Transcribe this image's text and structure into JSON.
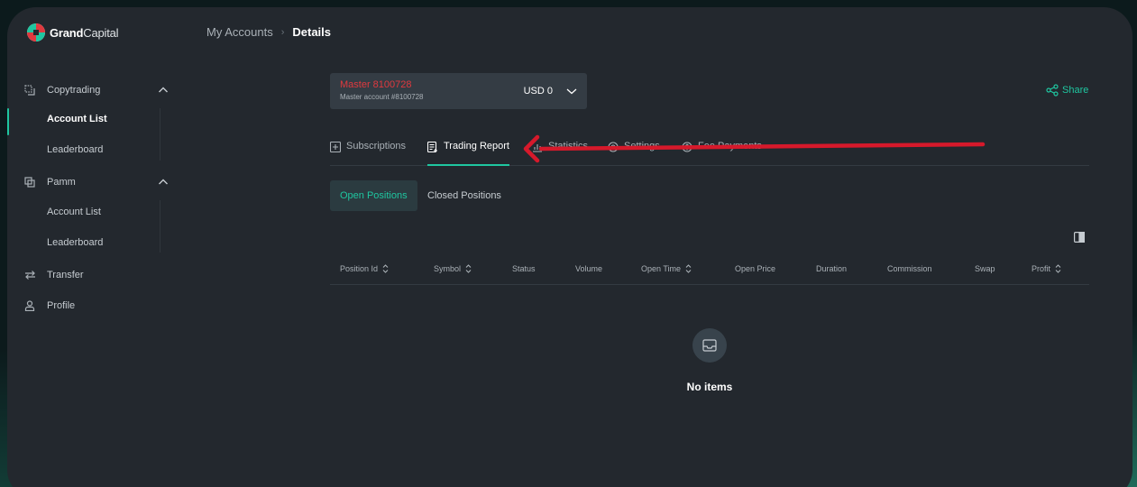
{
  "brand": {
    "name_bold": "Grand",
    "name_light": "Capital"
  },
  "breadcrumb": {
    "parent": "My Accounts",
    "separator": "›",
    "current": "Details"
  },
  "sidebar": {
    "sections": [
      {
        "label": "Copytrading",
        "icon": "copytrading-icon",
        "expanded": true,
        "items": [
          {
            "label": "Account List",
            "active": true
          },
          {
            "label": "Leaderboard",
            "active": false
          }
        ]
      },
      {
        "label": "Pamm",
        "icon": "pamm-icon",
        "expanded": true,
        "items": [
          {
            "label": "Account List",
            "active": false
          },
          {
            "label": "Leaderboard",
            "active": false
          }
        ]
      }
    ],
    "links": [
      {
        "label": "Transfer",
        "icon": "transfer-icon"
      },
      {
        "label": "Profile",
        "icon": "profile-icon"
      }
    ]
  },
  "account": {
    "name": "Master 8100728",
    "subtitle": "Master account #8100728",
    "balance": "USD 0"
  },
  "share_label": "Share",
  "tabs": [
    {
      "label": "Subscriptions",
      "icon": "plus-square-icon",
      "active": false
    },
    {
      "label": "Trading Report",
      "icon": "report-icon",
      "active": true
    },
    {
      "label": "Statistics",
      "icon": "chart-icon",
      "active": false
    },
    {
      "label": "Settings",
      "icon": "gear-icon",
      "active": false
    },
    {
      "label": "Fee Payments",
      "icon": "dollar-circle-icon",
      "active": false
    }
  ],
  "subtabs": [
    {
      "label": "Open Positions",
      "active": true
    },
    {
      "label": "Closed Positions",
      "active": false
    }
  ],
  "table": {
    "columns": [
      {
        "label": "Position Id",
        "sortable": true
      },
      {
        "label": "Symbol",
        "sortable": true
      },
      {
        "label": "Status",
        "sortable": false
      },
      {
        "label": "Volume",
        "sortable": false
      },
      {
        "label": "Open Time",
        "sortable": true
      },
      {
        "label": "Open Price",
        "sortable": false
      },
      {
        "label": "Duration",
        "sortable": false
      },
      {
        "label": "Commission",
        "sortable": false
      },
      {
        "label": "Swap",
        "sortable": false
      },
      {
        "label": "Profit",
        "sortable": true
      }
    ],
    "rows": [],
    "empty_text": "No items"
  },
  "colors": {
    "accent": "#1fc6a0",
    "account_name": "#e0393e",
    "annotation_arrow": "#d6192b",
    "panel": "#23282e"
  }
}
